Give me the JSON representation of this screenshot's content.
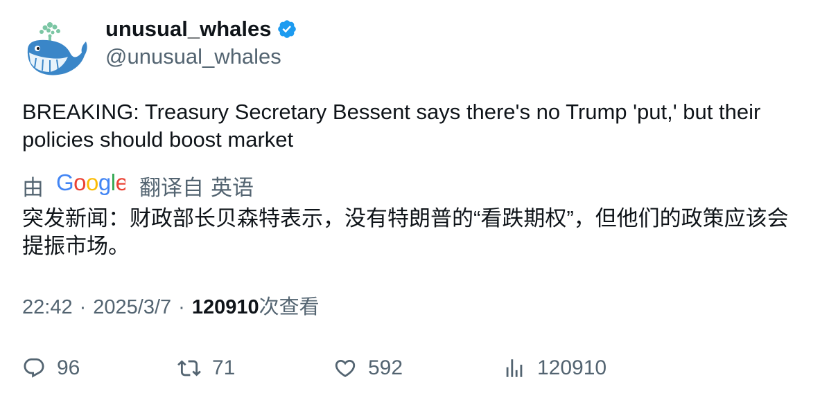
{
  "author": {
    "display_name": "unusual_whales",
    "handle": "@unusual_whales",
    "verified": true,
    "avatar_icon": "whale-avatar-icon",
    "verified_icon": "verified-badge-icon",
    "verified_color": "#1d9bf0"
  },
  "tweet": {
    "text": "BREAKING: Treasury Secretary Bessent says there's no Trump 'put,' but their policies should boost market"
  },
  "translation": {
    "prefix": "由",
    "provider": "Google",
    "suffix": "翻译自",
    "source_language": "英语",
    "text": "突发新闻：财政部长贝森特表示，没有特朗普的“看跌期权”，但他们的政策应该会提振市场。"
  },
  "meta": {
    "time": "22:42",
    "separator": "·",
    "date": "2025/3/7",
    "views_count": "120910",
    "views_label": "次查看"
  },
  "actions": {
    "replies": "96",
    "retweets": "71",
    "likes": "592",
    "views": "120910"
  },
  "colors": {
    "text_primary": "#0f1419",
    "text_secondary": "#536471",
    "brand_blue": "#1d9bf0"
  }
}
